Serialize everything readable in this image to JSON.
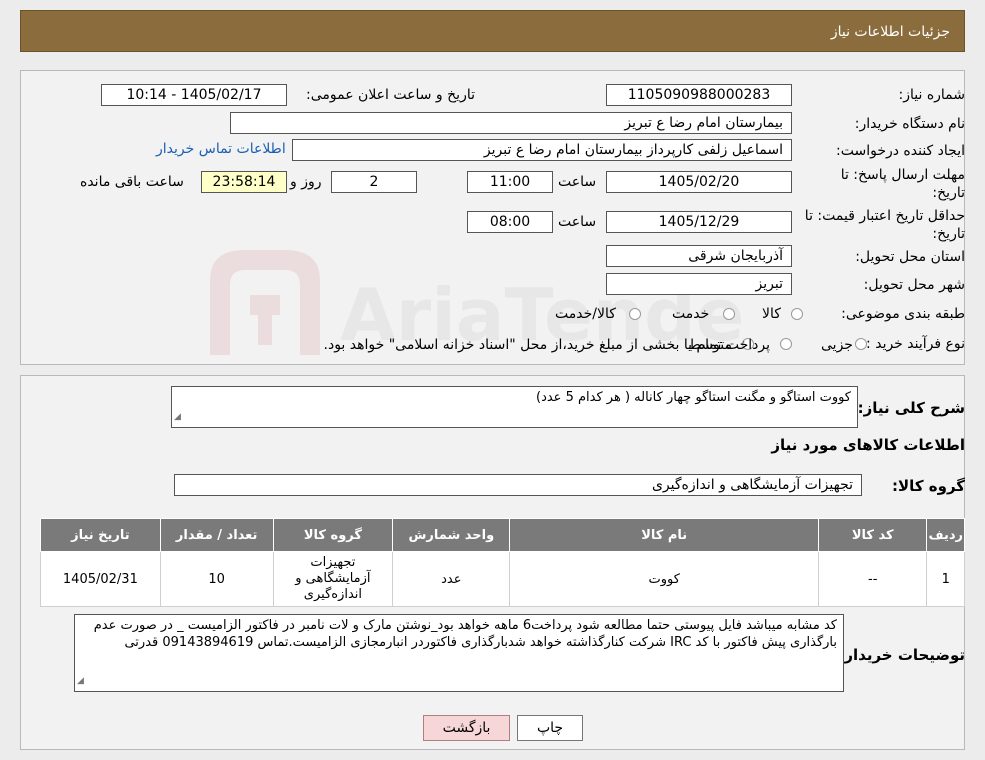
{
  "header": {
    "title": "جزئیات اطلاعات نیاز"
  },
  "form": {
    "need_number_label": "شماره نیاز:",
    "need_number": "1105090988000283",
    "announce_label": "تاریخ و ساعت اعلان عمومی:",
    "announce_value": "1405/02/17 - 10:14",
    "buyer_org_label": "نام دستگاه خریدار:",
    "buyer_org": "بیمارستان امام رضا  ع  تبریز",
    "creator_label": "ایجاد کننده درخواست:",
    "creator": "اسماعیل زلفی کارپرداز بیمارستان امام رضا  ع  تبریز",
    "contact_link": "اطلاعات تماس خریدار",
    "deadline_label_1": "مهلت ارسال پاسخ: تا",
    "deadline_label_2": "تاریخ:",
    "deadline_date": "1405/02/20",
    "hour_label": "ساعت",
    "deadline_time": "11:00",
    "days_value": "2",
    "days_label": "روز و",
    "remaining_time": "23:58:14",
    "remaining_label": "ساعت باقی مانده",
    "validity_label_1": "حداقل تاریخ اعتبار قیمت: تا",
    "validity_label_2": "تاریخ:",
    "validity_date": "1405/12/29",
    "validity_hour_label": "ساعت",
    "validity_time": "08:00",
    "province_label": "استان محل تحویل:",
    "province": "آذربایجان شرقی",
    "city_label": "شهر محل تحویل:",
    "city": "تبریز",
    "category_label": "طبقه بندی موضوعی:",
    "category_options": [
      "کالا",
      "خدمت",
      "کالا/خدمت"
    ],
    "process_label": "نوع فرآیند خرید :",
    "process_options": [
      "جزیی",
      "متوسط"
    ],
    "process_note": "پرداخت تمام یا بخشی از مبلغ خرید،از محل \"اسناد خزانه اسلامی\" خواهد بود."
  },
  "summary": {
    "desc_label": "شرح کلی نیاز:",
    "desc_value": "کووت استاگو و مگنت استاگو چهار کاناله ( هر کدام 5 عدد)",
    "goods_info_title": "اطلاعات کالاهای مورد نیاز",
    "group_label": "گروه کالا:",
    "group_value": "تجهیزات آزمایشگاهی و اندازه‌گیری"
  },
  "table": {
    "headers": [
      "ردیف",
      "کد کالا",
      "نام کالا",
      "واحد شمارش",
      "گروه کالا",
      "تعداد / مقدار",
      "تاریخ نیاز"
    ],
    "rows": [
      [
        "1",
        "--",
        "کووت",
        "عدد",
        "تجهیزات آزمایشگاهی و اندازه‌گیری",
        "10",
        "1405/02/31"
      ]
    ]
  },
  "notes": {
    "label": "توضیحات خریدار:",
    "value": "کد مشابه میباشد فایل پیوستی حتما مطالعه شود  پرداخت6 ماهه خواهد بود_نوشتن مارک و لات نامبر در فاکتور الزامیست _  در صورت عدم بارگذاری پیش فاکتور با کد IRC  شرکت کنارگذاشته خواهد شدبارگذاری فاکتوردر انبارمجازی الزامیست.تماس 09143894619 قدرتی"
  },
  "buttons": {
    "print": "چاپ",
    "back": "بازگشت"
  },
  "watermark": {
    "text": "AriaTender.neT"
  }
}
